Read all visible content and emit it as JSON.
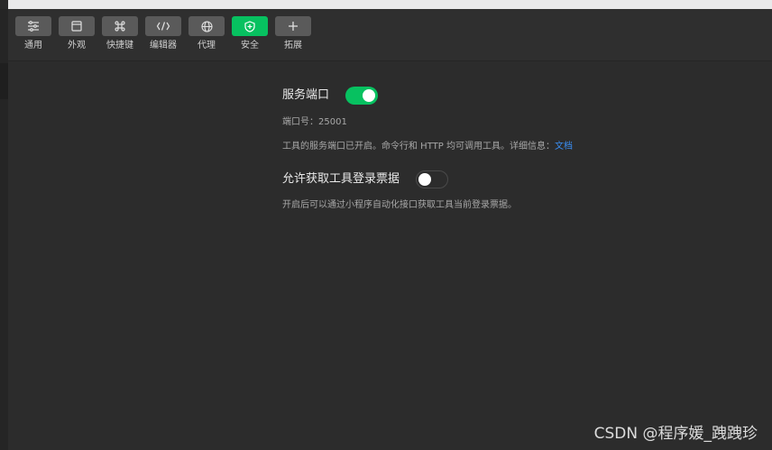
{
  "toolbar": {
    "items": [
      {
        "label": "通用",
        "icon": "sliders-icon",
        "active": false
      },
      {
        "label": "外观",
        "icon": "window-icon",
        "active": false
      },
      {
        "label": "快捷键",
        "icon": "command-key-icon",
        "active": false
      },
      {
        "label": "编辑器",
        "icon": "code-icon",
        "active": false
      },
      {
        "label": "代理",
        "icon": "globe-icon",
        "active": false
      },
      {
        "label": "安全",
        "icon": "shield-icon",
        "active": true
      },
      {
        "label": "拓展",
        "icon": "plus-icon",
        "active": false
      }
    ],
    "accent_color": "#07c160"
  },
  "settings": {
    "service_port": {
      "title": "服务端口",
      "enabled": true,
      "port_label": "端口号：25001",
      "description": "工具的服务端口已开启。命令行和 HTTP 均可调用工具。详细信息：",
      "link_text": "文档"
    },
    "login_ticket": {
      "title": "允许获取工具登录票据",
      "enabled": false,
      "description": "开启后可以通过小程序自动化接口获取工具当前登录票据。"
    }
  },
  "watermark": "CSDN @程序媛_跩跩珍"
}
